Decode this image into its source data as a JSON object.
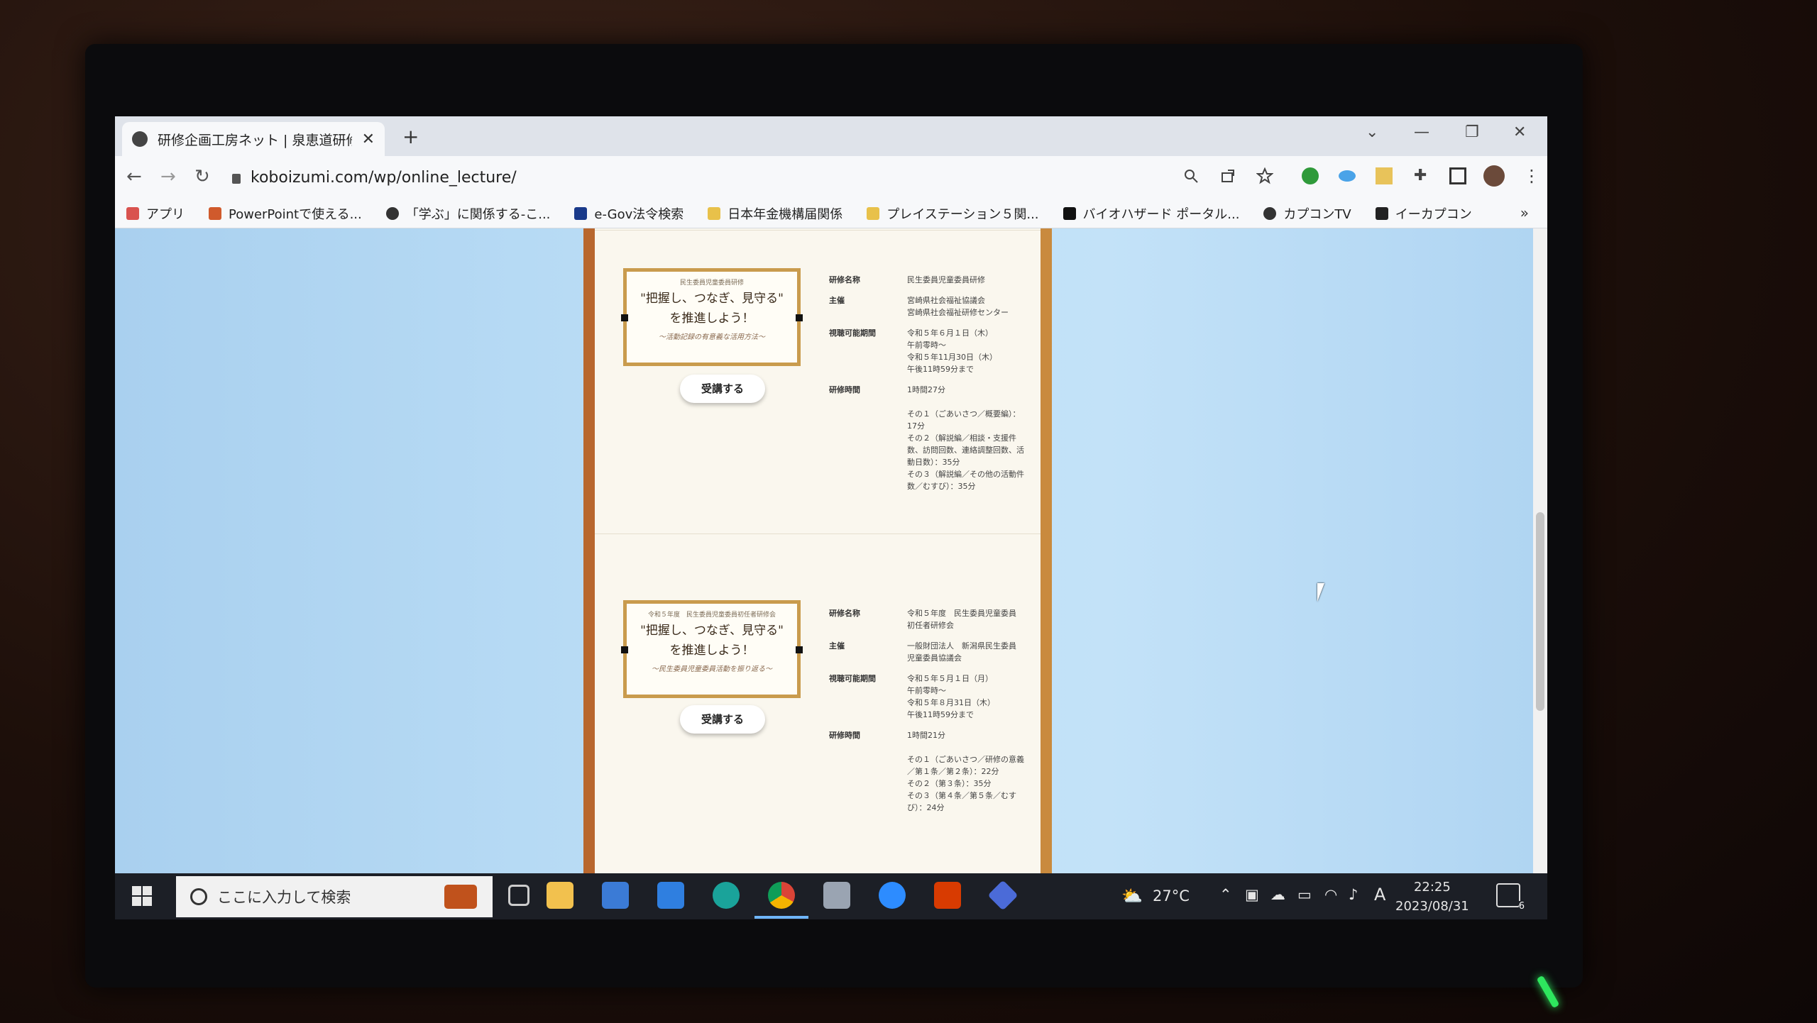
{
  "browser": {
    "tab_title": "研修企画工房ネット | 泉恵道研修...",
    "url": "koboizumi.com/wp/online_lecture/",
    "bookmarks": [
      {
        "label": "アプリ",
        "icon": "apps-grid-icon",
        "color": "#d9534f"
      },
      {
        "label": "PowerPointで使える...",
        "icon": "powerpoint-icon",
        "color": "#d05a2c"
      },
      {
        "label": "「学ぶ」に関係する-こ...",
        "icon": "globe-icon",
        "color": "#333333"
      },
      {
        "label": "e-Gov法令検索",
        "icon": "egov-icon",
        "color": "#1a3a8a"
      },
      {
        "label": "日本年金機構届関係",
        "icon": "folder-icon",
        "color": "#e8c14a"
      },
      {
        "label": "プレイステーション５関...",
        "icon": "folder-icon",
        "color": "#e8c14a"
      },
      {
        "label": "バイオハザード ポータル...",
        "icon": "biohazard-icon",
        "color": "#111111"
      },
      {
        "label": "カプコンTV",
        "icon": "capcom-icon",
        "color": "#333333"
      },
      {
        "label": "イーカプコン",
        "icon": "ecapcom-icon",
        "color": "#222222"
      }
    ],
    "bookmarks_more": "»"
  },
  "page": {
    "cards": [
      {
        "banner_small": "民生委員児童委員研修",
        "banner_main_1": "\"把握し、つなぎ、見守る\"",
        "banner_main_2": "を推進しよう！",
        "banner_sub": "〜活動記録の有意義な活用方法〜",
        "button": "受講する",
        "fields": [
          {
            "label": "研修名称",
            "value": "民生委員児童委員研修"
          },
          {
            "label": "主催",
            "value": "宮崎県社会福祉協議会\n宮崎県社会福祉研修センター"
          },
          {
            "label": "視聴可能期間",
            "value": "令和５年６月１日（木）\n午前零時〜\n令和５年11月30日（木）\n午後11時59分まで"
          },
          {
            "label": "研修時間",
            "value": "1時間27分\n\nその１（ごあいさつ／概要編）：17分\nその２（解説編／相談・支援件数、訪問回数、連絡調整回数、活動日数）：35分\nその３（解説編／その他の活動件数／むすび）：35分"
          }
        ]
      },
      {
        "banner_small": "令和５年度　民生委員児童委員初任者研修会",
        "banner_main_1": "\"把握し、つなぎ、見守る\"",
        "banner_main_2": "を推進しよう！",
        "banner_sub": "〜民生委員児童委員活動を振り返る〜",
        "button": "受講する",
        "fields": [
          {
            "label": "研修名称",
            "value": "令和５年度　民生委員児童委員\n初任者研修会"
          },
          {
            "label": "主催",
            "value": "一般財団法人　新潟県民生委員\n児童委員協議会"
          },
          {
            "label": "視聴可能期間",
            "value": "令和５年５月１日（月）\n午前零時〜\n令和５年８月31日（木）\n午後11時59分まで"
          },
          {
            "label": "研修時間",
            "value": "1時間21分\n\nその１（ごあいさつ／研修の意義／第１条／第２条）：22分\nその２（第３条）：35分\nその３（第４条／第５条／むすび）：24分"
          }
        ]
      }
    ]
  },
  "taskbar": {
    "search_placeholder": "ここに入力して検索",
    "temperature": "27°C",
    "ime": "A",
    "time": "22:25",
    "date": "2023/08/31",
    "notification_count": "6",
    "apps": [
      "task-view-icon",
      "file-explorer-icon",
      "microsoft-store-icon",
      "mail-icon",
      "edge-icon",
      "chrome-icon",
      "camera-icon",
      "zoom-icon",
      "office-icon",
      "copilot-icon"
    ]
  }
}
